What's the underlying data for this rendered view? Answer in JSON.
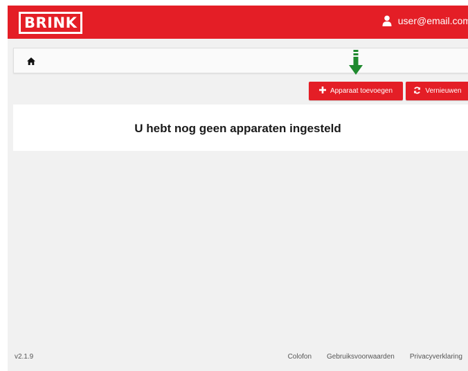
{
  "header": {
    "logo": "BRINK",
    "user_email": "user@email.com",
    "user_icon": "user-icon",
    "brand_color": "#e41e26"
  },
  "breadcrumb": {
    "home_icon": "home-icon"
  },
  "annotation": {
    "arrow_icon": "arrow-down-icon",
    "color": "#1f8a2e"
  },
  "toolbar": {
    "add_label": "Apparaat toevoegen",
    "add_icon": "plus-icon",
    "refresh_label": "Vernieuwen",
    "refresh_icon": "refresh-icon"
  },
  "main": {
    "empty_message": "U hebt nog geen apparaten ingesteld"
  },
  "footer": {
    "version": "v2.1.9",
    "links": [
      "Colofon",
      "Gebruiksvoorwaarden",
      "Privacyverklaring"
    ]
  }
}
